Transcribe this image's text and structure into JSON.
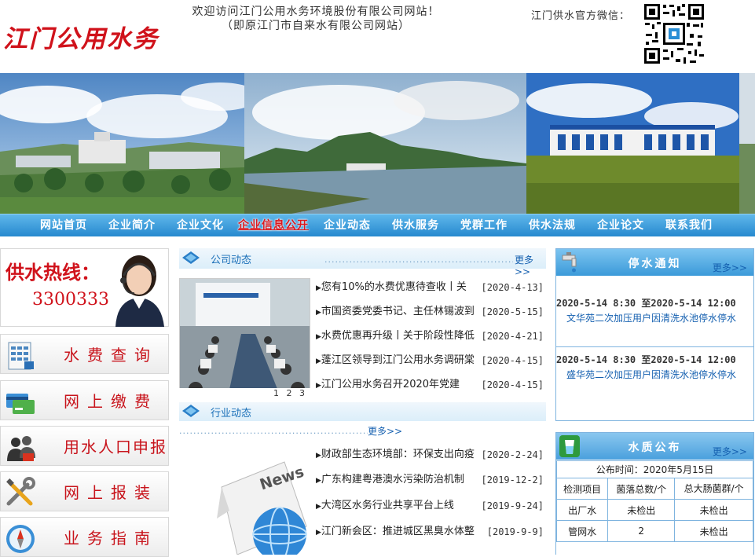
{
  "header": {
    "logo": "江门公用水务",
    "welcome_line1": "欢迎访问江门公用水务环境股份有限公司网站！",
    "welcome_line2": "（即原江门市自来水有限公司网站）",
    "wechat_label": "江门供水官方微信："
  },
  "nav": [
    "网站首页",
    "企业简介",
    "企业文化",
    "企业信息公开",
    "企业动态",
    "供水服务",
    "党群工作",
    "供水法规",
    "企业论文",
    "联系我们"
  ],
  "left": {
    "hotline_label": "供水热线：",
    "hotline_number": "3300333",
    "cards": [
      "水费查询",
      "网上缴费",
      "用水人口申报",
      "网上报装",
      "业务指南"
    ]
  },
  "company_news": {
    "title": "公司动态",
    "more": "更多>>",
    "pager": "1 2 3",
    "items": [
      {
        "title": "您有10%的水费优惠待查收丨关",
        "date": "[2020-4-13]"
      },
      {
        "title": "市国资委党委书记、主任林锡波到",
        "date": "[2020-5-15]"
      },
      {
        "title": "水费优惠再升级丨关于阶段性降低",
        "date": "[2020-4-21]"
      },
      {
        "title": "蓬江区领导到江门公用水务调研棠",
        "date": "[2020-4-15]"
      },
      {
        "title": "江门公用水务召开2020年党建",
        "date": "[2020-4-15]"
      }
    ]
  },
  "industry_news": {
    "title": "行业动态",
    "more": "更多>>",
    "image_text": "News",
    "items": [
      {
        "title": "财政部生态环境部：环保支出向疫",
        "date": "[2020-2-24]"
      },
      {
        "title": "广东构建粤港澳水污染防治机制",
        "date": "[2019-12-2]"
      },
      {
        "title": "大湾区水务行业共享平台上线",
        "date": "[2019-9-24]"
      },
      {
        "title": "江门新会区：推进城区黑臭水体整",
        "date": "[2019-9-9]"
      }
    ]
  },
  "outage": {
    "title": "停水通知",
    "more": "更多>>",
    "items": [
      {
        "time": "2020-5-14 8:30  至2020-5-14 12:00",
        "text": "文华苑二次加压用户因清洗水池停水停水"
      },
      {
        "time": "2020-5-14 8:30  至2020-5-14 12:00",
        "text": "盛华苑二次加压用户因清洗水池停水停水"
      }
    ]
  },
  "quality": {
    "title": "水质公布",
    "more": "更多>>",
    "publish_time": "公布时间：2020年5月15日",
    "headers": [
      "检测项目",
      "菌落总数/个",
      "总大肠菌群/个"
    ],
    "rows": [
      [
        "出厂水",
        "未检出",
        "未检出"
      ],
      [
        "管网水",
        "2",
        "未检出"
      ]
    ]
  },
  "colors": {
    "brand_red": "#d0121b",
    "nav_blue": "#2689cf",
    "link_blue": "#1560b0"
  }
}
